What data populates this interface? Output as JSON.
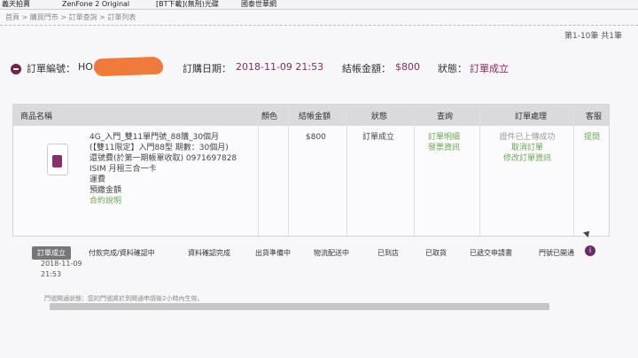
{
  "bookmarks": [
    "義天拍賣",
    "ZenFone 2 Original",
    "[BT下載](無刑)光碟",
    "國泰世華網"
  ],
  "breadcrumb": "首頁 > 購買門市 > 訂單查詢 > 訂單列表",
  "pagination": "第1-10筆 共1筆",
  "order": {
    "number_label": "訂單編號：",
    "number_value": "HO…54",
    "date_label": "訂購日期：",
    "date_value": "2018-11-09 21:53",
    "amount_label": "結帳金額：",
    "amount_value": "$800",
    "status_label": "狀態：",
    "status_value": "訂單成立"
  },
  "table": {
    "headers": [
      "商品名稱",
      "顏色",
      "結帳金額",
      "狀態",
      "查詢",
      "訂單處理",
      "客服"
    ],
    "product_lines": [
      "4G_入門_雙11單門號_88購_30個月",
      "(【雙11限定】入門88型 期數：30個月)",
      "還號費(於第一期帳單收取) 0971697828",
      "ISIM 月租三合一卡",
      "運費",
      "預繳金額"
    ],
    "product_link": "合約說明",
    "amount": "$800",
    "status": "訂單成立",
    "query_links": [
      "訂單明細",
      "發票資訊"
    ],
    "process_lines": [
      "證件已上傳成功",
      "取消訂單",
      "修改訂單資訊"
    ],
    "service_link": "提問"
  },
  "steps": [
    "訂單成立",
    "付款完成/資料確認中",
    "資料確認完成",
    "出貨準備中",
    "物流配送中",
    "已到店",
    "已取貨",
    "已遞交申請書",
    "門號已開通"
  ],
  "step_date": "2018-11-09",
  "step_time": "21:53",
  "note": "門號開通狀態：您的門號將於到開通申請後2小時內生效。"
}
